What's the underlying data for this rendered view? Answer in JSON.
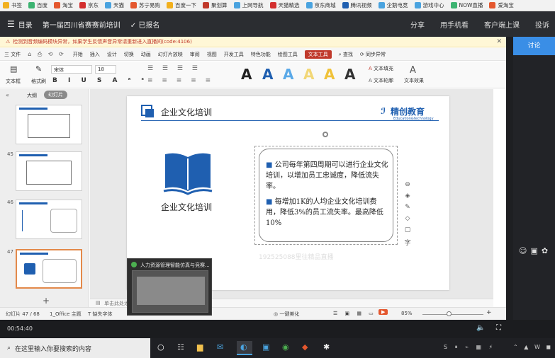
{
  "bookmarks": [
    "书签",
    "百度",
    "淘宝",
    "京东",
    "天猫",
    "苏宁易购",
    "百度一下",
    "聚划算",
    "上网导航",
    "天猫精选",
    "京东商城",
    "腾讯视频",
    "企鹅电竞",
    "游戏中心",
    "NOW直播",
    "爱淘宝"
  ],
  "course": {
    "menu_label": "目录",
    "title": "第一届四川省赛赛前培训",
    "status": "✓ 已报名",
    "actions": [
      "分享",
      "用手机看",
      "客户端上课",
      "投诉"
    ]
  },
  "side_panel": {
    "tab": "讨论"
  },
  "notice": "检测到音频编码模块异常，如果学生反馈声音异常请重新进入直播间(code:4106)",
  "menubar": {
    "file": "三 文件",
    "items": [
      "开始",
      "插入",
      "设计",
      "切换",
      "动画",
      "幻灯片放映",
      "审阅",
      "视图",
      "开发工具",
      "特色功能",
      "绘图工具",
      "文本工具"
    ],
    "active": "文本工具",
    "search": "查找",
    "sync": "同步异常"
  },
  "toolbar": {
    "textbox": "文本框",
    "format_brush": "格式刷",
    "font": "宋体",
    "size": "18",
    "fill": "文本填充",
    "outline": "文本轮廓",
    "effect": "文本效果"
  },
  "slide_panel": {
    "tab_outline": "大纲",
    "tab_slides": "幻灯片",
    "numbers": [
      "45",
      "46",
      "47"
    ],
    "notes": "单击此处添"
  },
  "slide": {
    "title": "企业文化培训",
    "logo_text": "精创教育",
    "logo_sub": "Education&technology",
    "icon_label": "企业文化培训",
    "bullet1": "公司每年第四周期可以进行企业文化培训，以增加员工忠诚度，降低流失率。",
    "bullet2": "每增加1K的人均企业文化培训费用，降低3%的员工流失率。最高降低10%",
    "watermark": "192525088里往精品直播"
  },
  "statusbar": {
    "slide_info": "幻灯片 47 / 68",
    "theme": "1_Office 主题",
    "missing_font": "缺失字体",
    "beautify": "一键美化",
    "zoom": "85%"
  },
  "popup": {
    "title": "人力资源管理智能仿真与竞赛..."
  },
  "video": {
    "time": "00:54:40"
  },
  "taskbar": {
    "search_placeholder": "在这里输入你要搜索的内容"
  },
  "colors": {
    "accent": "#c0392b",
    "brand_blue": "#1f5fb0",
    "highlight": "#3a8ee6"
  }
}
